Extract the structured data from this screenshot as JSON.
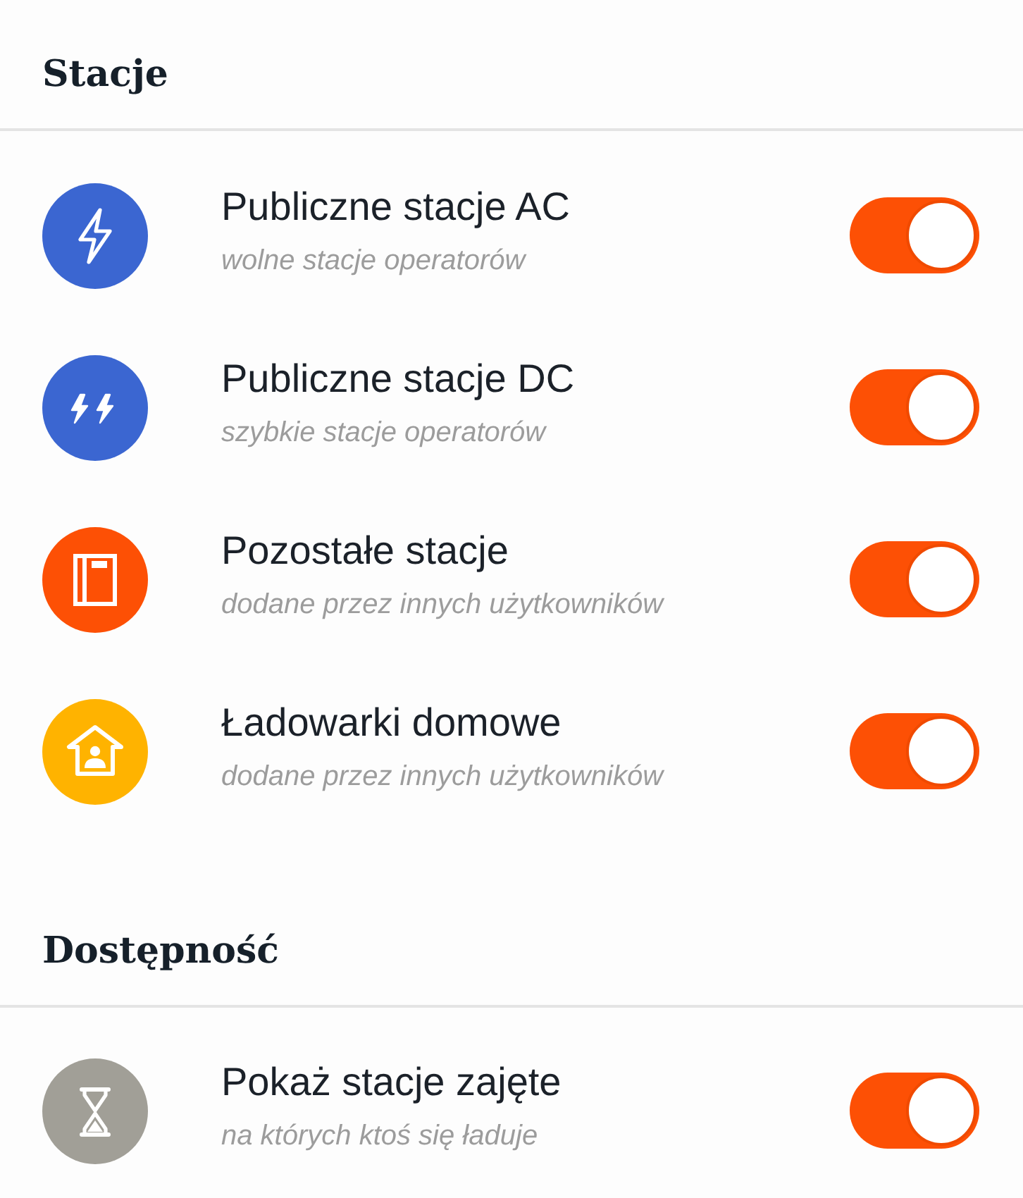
{
  "sections": [
    {
      "title": "Stacje",
      "items": [
        {
          "kind": "bolt",
          "color": "#3b66d1",
          "title": "Publiczne stacje AC",
          "subtitle": "wolne stacje operatorów",
          "on": true
        },
        {
          "kind": "double-bolt",
          "color": "#3b66d1",
          "title": "Publiczne stacje DC",
          "subtitle": "szybkie stacje operatorów",
          "on": true
        },
        {
          "kind": "book",
          "color": "#fd5005",
          "title": "Pozostałe stacje",
          "subtitle": "dodane przez innych użytkowników",
          "on": true
        },
        {
          "kind": "house",
          "color": "#ffb300",
          "title": "Ładowarki domowe",
          "subtitle": "dodane przez innych użytkowników",
          "on": true
        }
      ]
    },
    {
      "title": "Dostępność",
      "items": [
        {
          "kind": "hourglass",
          "color": "#a19f97",
          "title": "Pokaż stacje zajęte",
          "subtitle": "na których ktoś się ładuje",
          "on": true
        }
      ]
    }
  ]
}
